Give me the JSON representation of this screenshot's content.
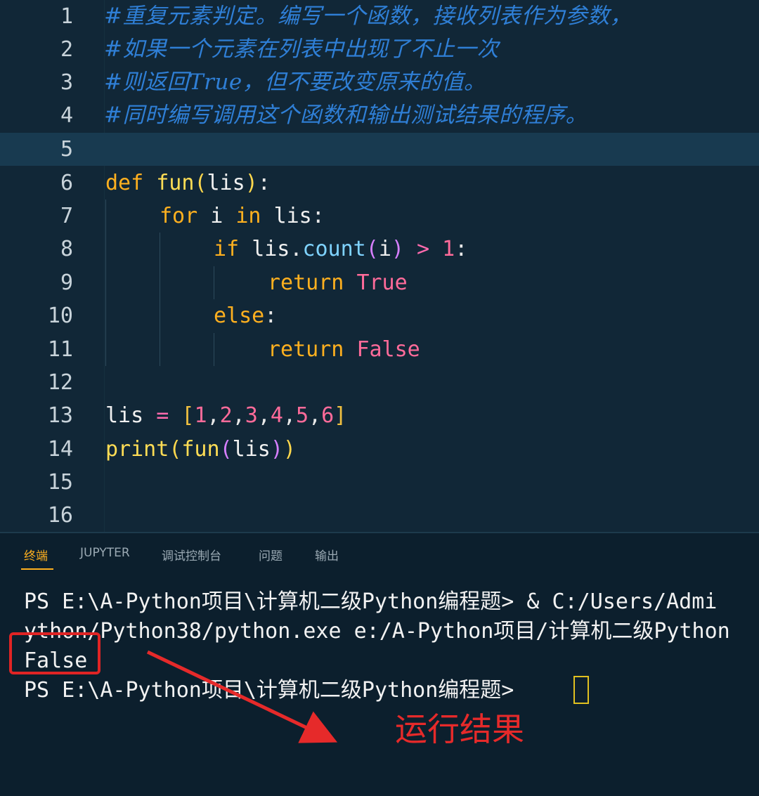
{
  "editor": {
    "lines": [
      {
        "n": "1",
        "comment": "#重复元素判定。编写一个函数，接收列表作为参数，"
      },
      {
        "n": "2",
        "comment": "#如果一个元素在列表中出现了不止一次"
      },
      {
        "n": "3",
        "comment": "#则返回True，但不要改变原来的值。"
      },
      {
        "n": "4",
        "comment": "#同时编写调用这个函数和输出测试结果的程序。"
      },
      {
        "n": "5"
      },
      {
        "n": "6"
      },
      {
        "n": "7"
      },
      {
        "n": "8"
      },
      {
        "n": "9"
      },
      {
        "n": "10"
      },
      {
        "n": "11"
      },
      {
        "n": "12"
      },
      {
        "n": "13"
      },
      {
        "n": "14"
      },
      {
        "n": "15"
      },
      {
        "n": "16"
      }
    ],
    "tokens": {
      "def": "def",
      "fun": "fun",
      "lis": "lis",
      "for": "for",
      "i": "i",
      "in": "in",
      "if": "if",
      "count": "count",
      "gt": ">",
      "one": "1",
      "return": "return",
      "true": "True",
      "else": "else",
      "false": "False",
      "eq": "=",
      "n1": "1",
      "n2": "2",
      "n3": "3",
      "n4": "4",
      "n5": "5",
      "n6": "6",
      "print": "print"
    }
  },
  "panel": {
    "tabs": [
      "终端",
      "JUPYTER",
      "调试控制台",
      "问题",
      "输出"
    ],
    "terminal": {
      "line1": "PS E:\\A-Python项目\\计算机二级Python编程题> & C:/Users/Admi",
      "line2": "ython/Python38/python.exe e:/A-Python项目/计算机二级Python",
      "line3": "False",
      "line4": "PS E:\\A-Python项目\\计算机二级Python编程题> "
    }
  },
  "annotation": {
    "label": "运行结果",
    "color": "#e62a2a"
  }
}
